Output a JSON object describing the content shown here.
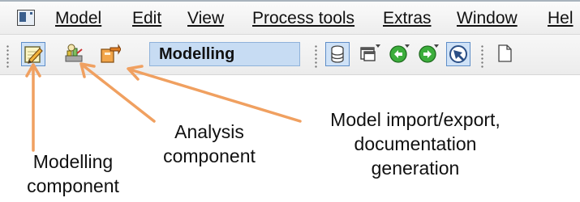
{
  "menubar": {
    "app_icon": "window-icon",
    "items": [
      {
        "label": "Model"
      },
      {
        "label": "Edit"
      },
      {
        "label": "View"
      },
      {
        "label": "Process tools"
      },
      {
        "label": "Extras"
      },
      {
        "label": "Window"
      },
      {
        "label": "Hel"
      }
    ]
  },
  "toolbar": {
    "mode_selector_value": "Modelling",
    "buttons": [
      {
        "icon": "pencil-notepad-icon",
        "active": true
      },
      {
        "icon": "analysis-icon",
        "active": false
      },
      {
        "icon": "export-icon",
        "active": false
      },
      {
        "icon": "database-icon",
        "active": true
      },
      {
        "icon": "windows-icon",
        "active": false
      },
      {
        "icon": "back-arrow-icon",
        "active": false
      },
      {
        "icon": "forward-arrow-icon",
        "active": false
      },
      {
        "icon": "navigator-icon",
        "active": true
      },
      {
        "icon": "new-document-icon",
        "active": false
      }
    ]
  },
  "annotations": {
    "modelling": {
      "line1": "Modelling",
      "line2": "component"
    },
    "analysis": {
      "line1": "Analysis",
      "line2": "component"
    },
    "import_export": {
      "line1": "Model import/export,",
      "line2": "documentation",
      "line3": "generation"
    },
    "arrow_color": "#f0a060"
  }
}
